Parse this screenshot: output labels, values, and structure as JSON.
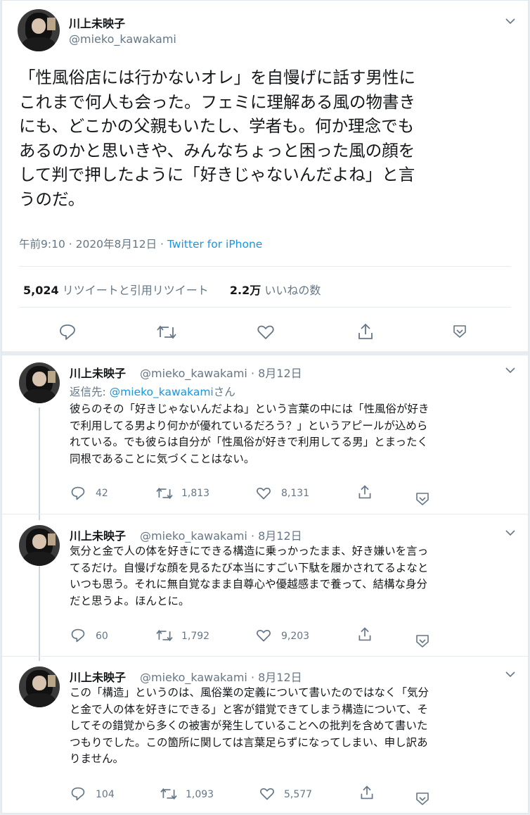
{
  "main": {
    "name": "川上未映子",
    "handle": "@mieko_kawakami",
    "text": "「性風俗店には行かないオレ」を自慢げに話す男性に\nこれまで何人も会った。フェミに理解ある風の物書き\nにも、どこかの父親もいたし、学者も。何か理念でも\nあるのかと思いきや、みんなちょっと困った風の顔を\nして判で押したように「好きじゃないんだよね」と言\nうのだ。",
    "time": "午前9:10",
    "date": "2020年8月12日",
    "source": "Twitter for iPhone",
    "retweets": "5,024",
    "retweets_label": "リツイートと引用リツイート",
    "likes": "2.2万",
    "likes_label": "いいねの数"
  },
  "replies": [
    {
      "name": "川上未映子",
      "handle": "@mieko_kawakami",
      "date": "8月12日",
      "reply_to_prefix": "返信先: ",
      "reply_to_handle": "@mieko_kawakami",
      "reply_to_suffix": "さん",
      "text": "彼らのその「好きじゃないんだよね」という言葉の中には「性風俗が好き\nで利用してる男より何かが優れているだろう？」というアピールが込めら\nれている。でも彼らは自分が「性風俗が好きで利用してる男」とまったく\n同根であることに気づくことはない。",
      "replies_count": "42",
      "retweets_count": "1,813",
      "likes_count": "8,131"
    },
    {
      "name": "川上未映子",
      "handle": "@mieko_kawakami",
      "date": "8月12日",
      "text": "気分と金で人の体を好きにできる構造に乗っかったまま、好き嫌いを言っ\nてるだけ。自慢げな顔を見るたび本当にすごい下駄を履かされてるよなと\nいつも思う。それに無自覚なまま自尊心や優越感まで養って、結構な身分\nだと思うよ。ほんとに。",
      "replies_count": "60",
      "retweets_count": "1,792",
      "likes_count": "9,203"
    },
    {
      "name": "川上未映子",
      "handle": "@mieko_kawakami",
      "date": "8月12日",
      "text": "この「構造」というのは、風俗業の定義について書いたのではなく「気分\nと金で人の体を好きにできる」と客が錯覚できてしまう構造について、そ\nしてその錯覚から多くの被害が発生していることへの批判を含めて書いた\nつもりでした。この箇所に関しては言葉足らずになってしまい、申し訳あ\nりません。",
      "replies_count": "104",
      "retweets_count": "1,093",
      "likes_count": "5,577"
    }
  ],
  "separator": " · ",
  "colors": {
    "link": "#1b95e0",
    "secondary": "#657786",
    "text": "#14171a"
  },
  "icons": [
    "reply-icon",
    "retweet-icon",
    "like-icon",
    "share-icon",
    "chevron-down-icon",
    "avatar"
  ]
}
